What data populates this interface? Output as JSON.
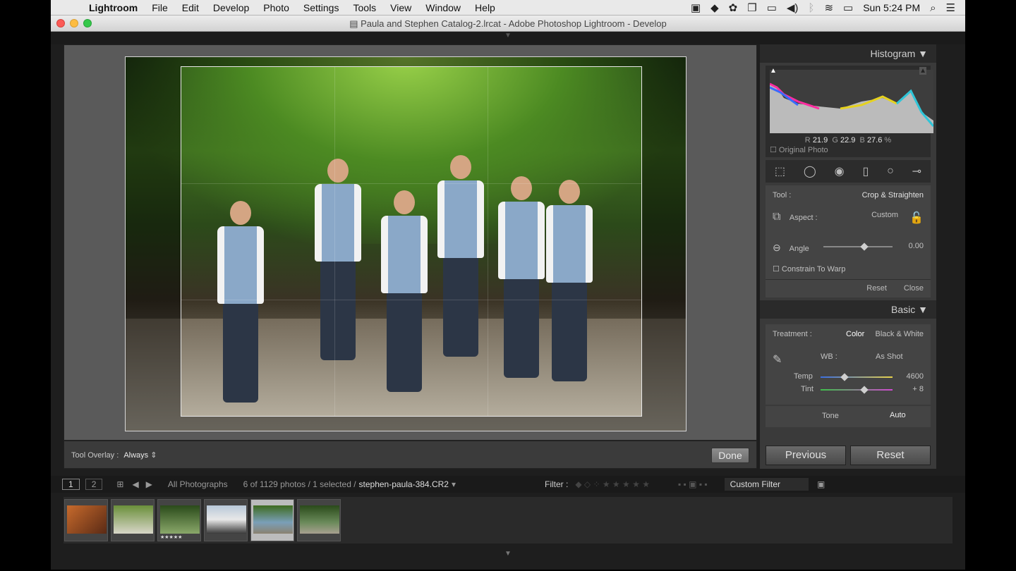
{
  "menubar": {
    "app": "Lightroom",
    "items": [
      "File",
      "Edit",
      "Develop",
      "Photo",
      "Settings",
      "Tools",
      "View",
      "Window",
      "Help"
    ],
    "clock": "Sun 5:24 PM"
  },
  "titlebar": {
    "title": "Paula and Stephen Catalog-2.lrcat - Adobe Photoshop Lightroom - Develop"
  },
  "toolbar": {
    "overlay_label": "Tool Overlay :",
    "overlay_value": "Always",
    "done_label": "Done"
  },
  "histogram": {
    "title": "Histogram",
    "r_label": "R",
    "r": "21.9",
    "g_label": "G",
    "g": "22.9",
    "b_label": "B",
    "b": "27.6",
    "unit": "%",
    "original_photo": "Original Photo"
  },
  "crop": {
    "tool_label": "Tool :",
    "tool_value": "Crop & Straighten",
    "aspect_label": "Aspect :",
    "aspect_value": "Custom",
    "angle_label": "Angle",
    "angle_value": "0.00",
    "constrain_label": "Constrain To Warp",
    "reset_label": "Reset",
    "close_label": "Close"
  },
  "basic": {
    "title": "Basic",
    "treatment_label": "Treatment :",
    "color_label": "Color",
    "bw_label": "Black & White",
    "wb_label": "WB :",
    "wb_value": "As Shot",
    "temp_label": "Temp",
    "temp_value": "4600",
    "tint_label": "Tint",
    "tint_value": "+ 8",
    "tone_label": "Tone",
    "auto_label": "Auto"
  },
  "panel_buttons": {
    "previous": "Previous",
    "reset": "Reset"
  },
  "filmstrip": {
    "view1": "1",
    "view2": "2",
    "source": "All Photographs",
    "count": "6 of 1129 photos / 1 selected /",
    "filename": "stephen-paula-384.CR2",
    "filter_label": "Filter :",
    "custom_filter": "Custom Filter"
  }
}
